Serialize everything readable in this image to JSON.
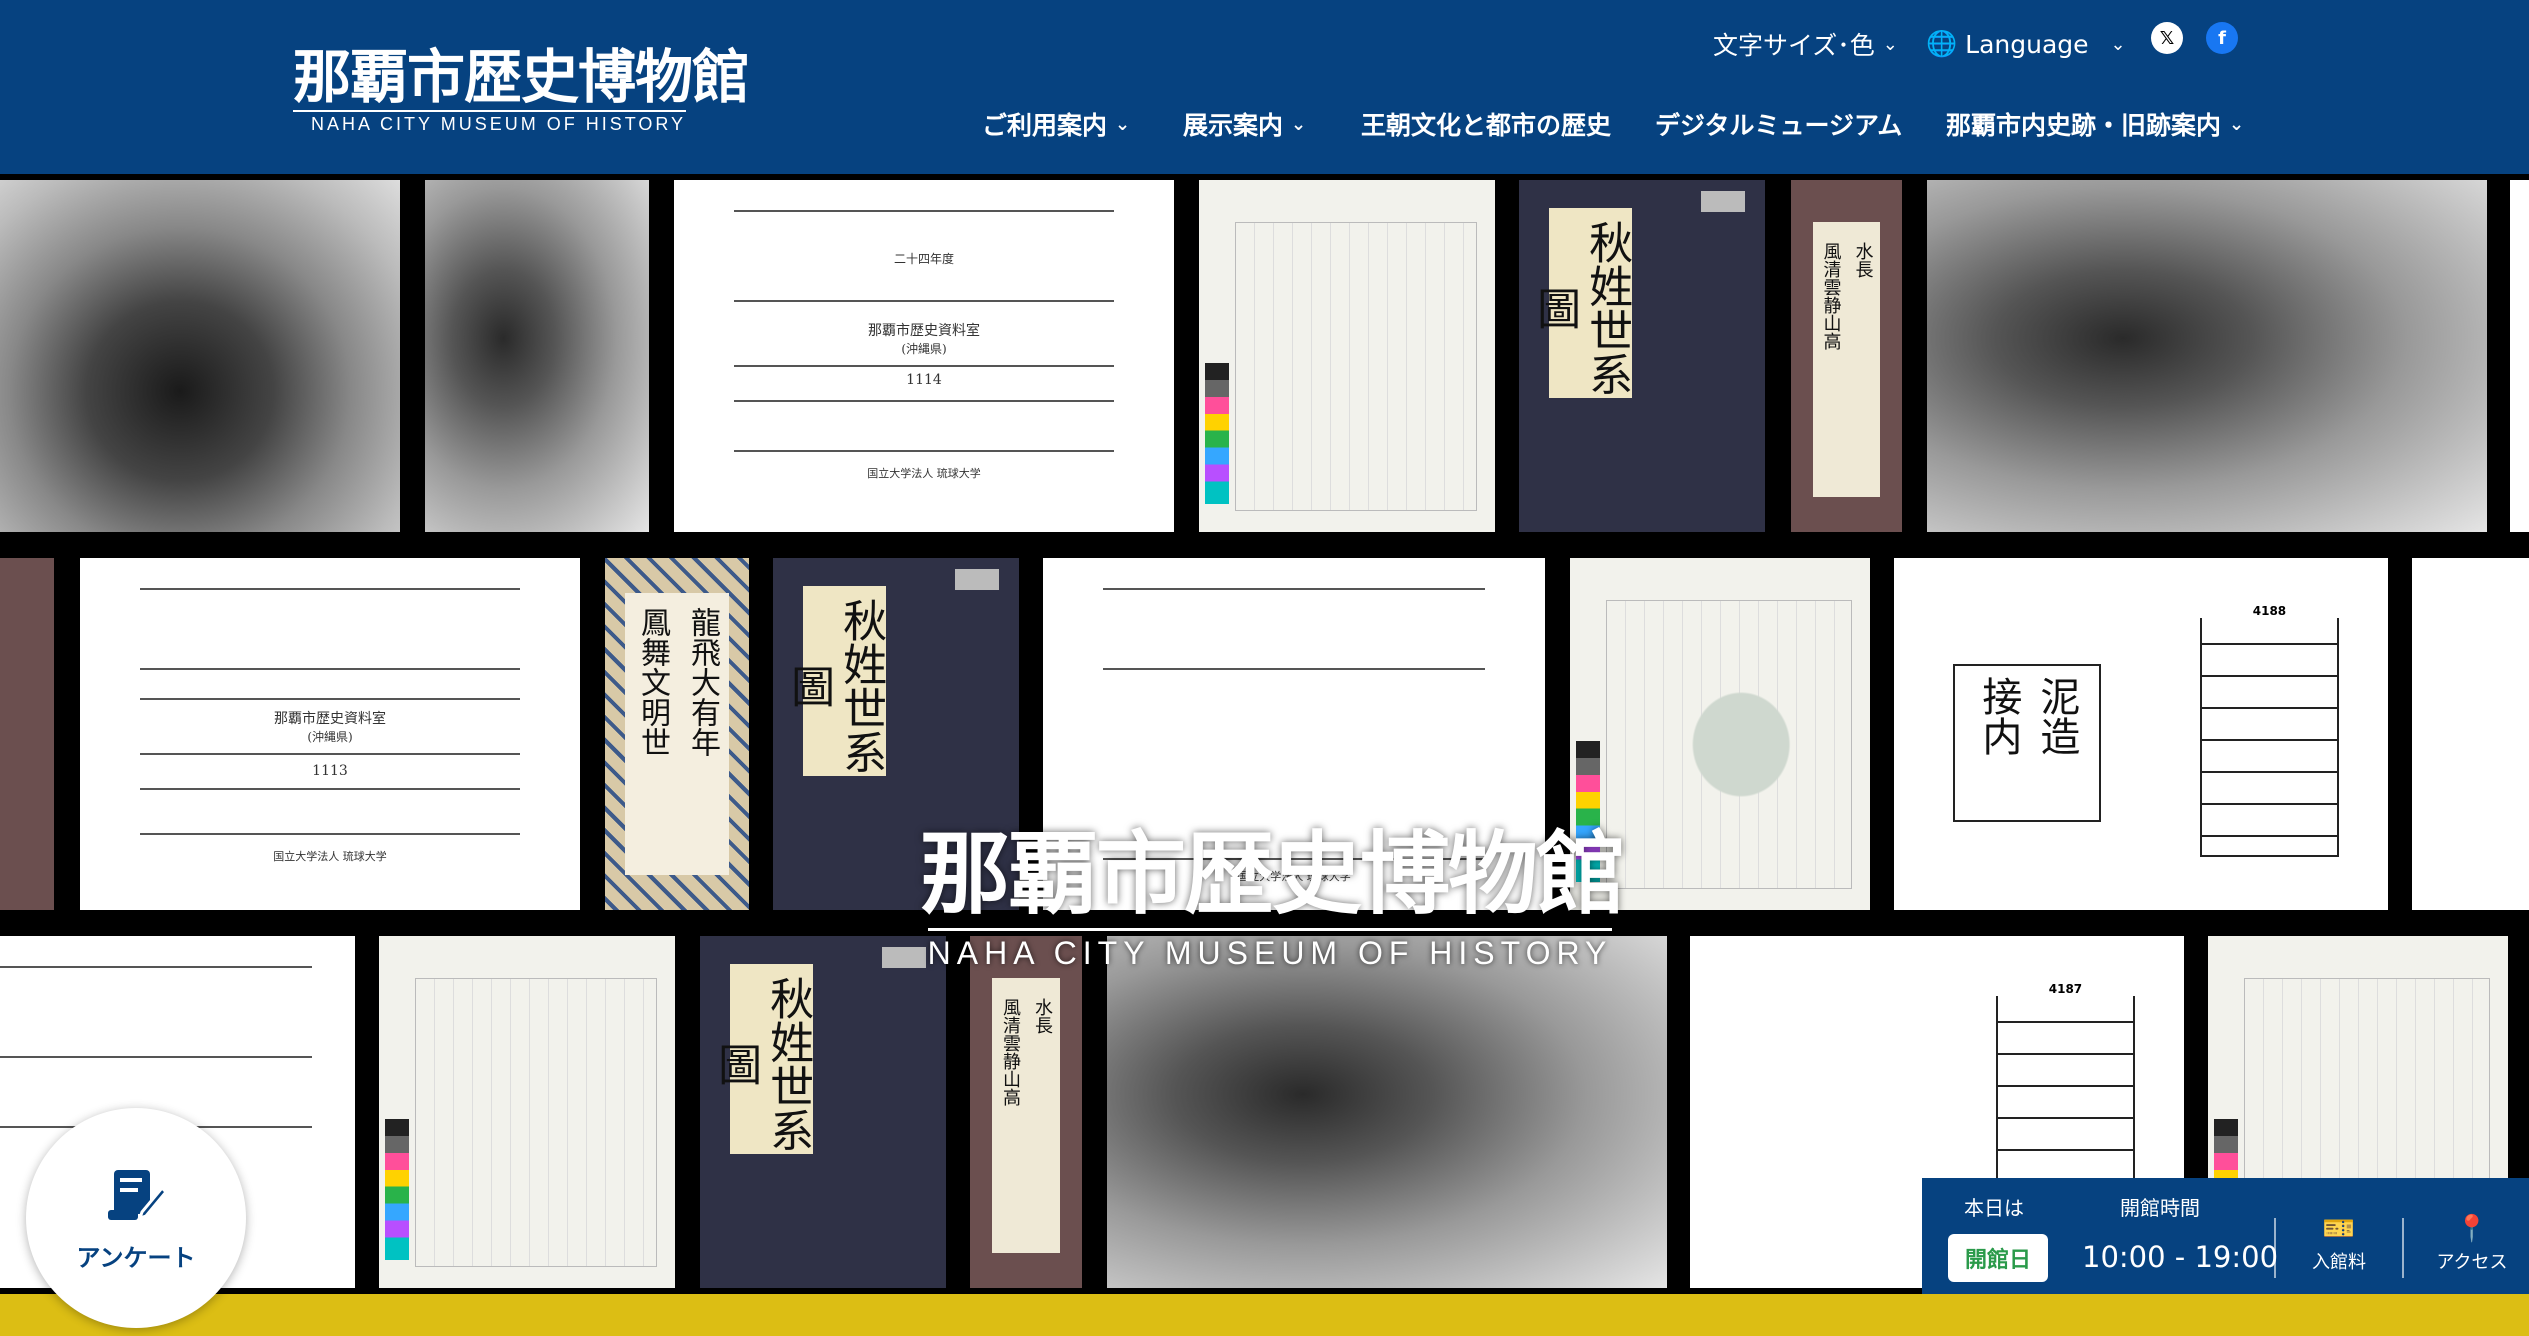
{
  "header": {
    "logo_jp": "那覇市歴史博物館",
    "logo_en": "NAHA CITY MUSEUM OF HISTORY",
    "text_size_color": "文字サイズ･色",
    "language": "Language",
    "nav": [
      {
        "label": "ご利用案内",
        "dropdown": true
      },
      {
        "label": "展示案内",
        "dropdown": true
      },
      {
        "label": "王朝文化と都市の歴史",
        "dropdown": false
      },
      {
        "label": "デジタルミュージアム",
        "dropdown": false
      },
      {
        "label": "那覇市内史跡・旧跡案内",
        "dropdown": true
      }
    ],
    "social": {
      "x": "𝕏",
      "facebook": "f"
    }
  },
  "hero": {
    "logo_jp": "那覇市歴史博物館",
    "logo_en": "NAHA CITY MUSEUM OF HISTORY",
    "doc1": {
      "l1": "二十四年度",
      "l2": "那覇市歴史資料室",
      "l3": "(沖縄県)",
      "num": "1114",
      "foot": "国立大学法人 琉球大学"
    },
    "doc2": {
      "l1": "那覇市歴史資料室",
      "l2": "(沖縄県)",
      "num": "1113",
      "foot": "国立大学法人 琉球大学"
    },
    "doc3": {
      "foot": "国立大学法人 琉球大学"
    },
    "book_title": "秋姓世系圖",
    "scroll_text": [
      "風清雲静山高",
      "水長"
    ],
    "scroll2_text": [
      "鳳舞文明世",
      "龍飛大有年"
    ],
    "form1": {
      "id": "4188",
      "kind": "文書",
      "cal": [
        "接内",
        "泥造"
      ]
    },
    "form2": {
      "id": "4187",
      "kind": "文書"
    }
  },
  "survey": {
    "label": "アンケート"
  },
  "infobar": {
    "today_label": "本日は",
    "status": "開館日",
    "hours_label": "開館時間",
    "hours": "10:00 - 19:00",
    "admission": "入館料",
    "access": "アクセス"
  },
  "colors": {
    "header_bg": "#064280",
    "accent_yellow": "#dcbe14",
    "open_green": "#2a9a4a"
  }
}
